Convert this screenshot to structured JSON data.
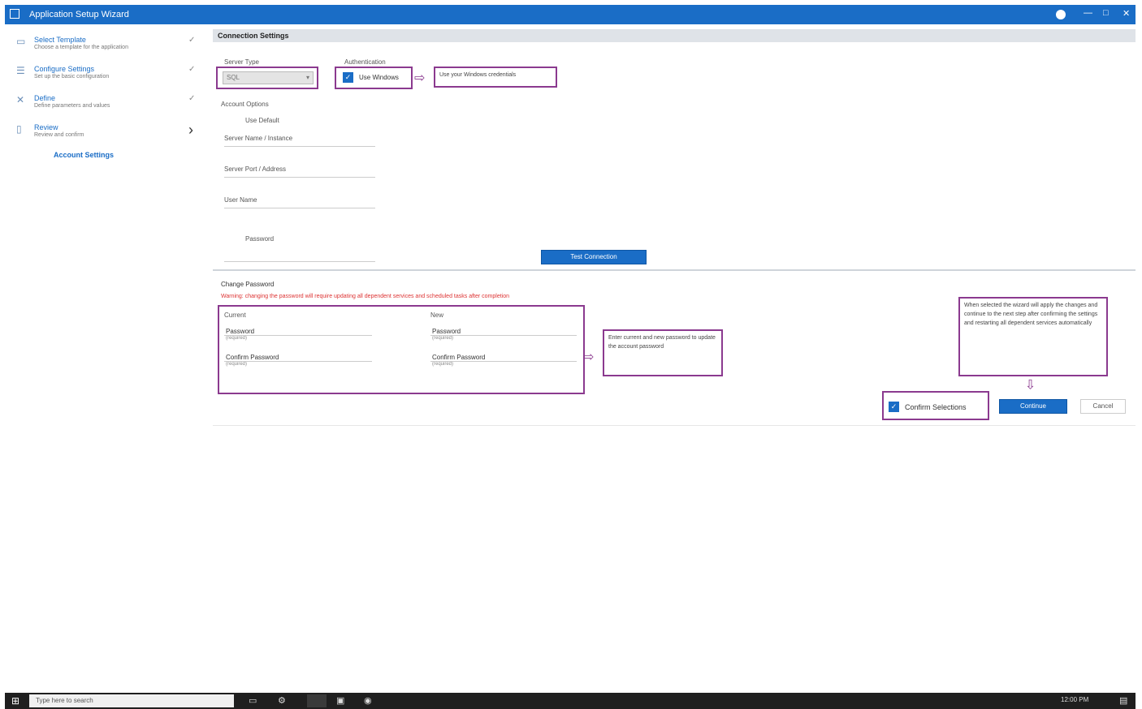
{
  "window": {
    "title": "Application Setup Wizard",
    "minimize": "—",
    "maximize": "□",
    "close": "✕"
  },
  "sidebar": {
    "steps": [
      {
        "name": "Select Template",
        "desc": "Choose a template for the application",
        "icon": "template-icon",
        "glyph": "▭",
        "state": "done"
      },
      {
        "name": "Configure Settings",
        "desc": "Set up the basic configuration",
        "icon": "settings-icon",
        "glyph": "☰",
        "state": "done"
      },
      {
        "name": "Define",
        "desc": "Define parameters and values",
        "icon": "tools-icon",
        "glyph": "✕",
        "state": "done"
      },
      {
        "name": "Review",
        "desc": "Review and confirm",
        "icon": "document-icon",
        "glyph": "▯",
        "state": "current"
      }
    ],
    "substep": "Account Settings"
  },
  "main": {
    "section_title": "Connection Settings",
    "server_type_label": "Server Type",
    "server_type_value": "SQL",
    "use_windows_label": "Authentication",
    "use_windows_checkbox": "Use Windows",
    "note_windows": "Use your Windows credentials",
    "account_label": "Account Options",
    "account_sub": "Use Default",
    "server_name_label": "Server Name / Instance",
    "server_port_label": "Server Port / Address",
    "server_user_label": "User Name",
    "password_label": "Password",
    "test_button": "Test Connection",
    "change_password_label": "Change Password",
    "warning_text": "Warning: changing the password will require updating all dependent services and scheduled tasks after completion",
    "col1_label": "Current",
    "col2_label": "New",
    "col1_val1": "Password",
    "col1_sub1": "(required)",
    "col1_val2": "Confirm Password",
    "col1_sub2": "(required)",
    "col2_val1": "Password",
    "col2_sub1": "(required)",
    "col2_val2": "Confirm Password",
    "col2_sub2": "(required)",
    "note_password": "Enter current and new password to update the account password",
    "note_confirm": "When selected the wizard will apply the changes and continue to the next step after confirming the settings and restarting all dependent services automatically",
    "confirm_checkbox": "Confirm Selections",
    "primary_button": "Continue",
    "cancel_button": "Cancel"
  },
  "taskbar": {
    "search_placeholder": "Type here to search",
    "clock": "12:00 PM"
  },
  "colors": {
    "accent": "#1a6dc6",
    "annotation": "#8b3a8f",
    "warning": "#dd3333"
  }
}
